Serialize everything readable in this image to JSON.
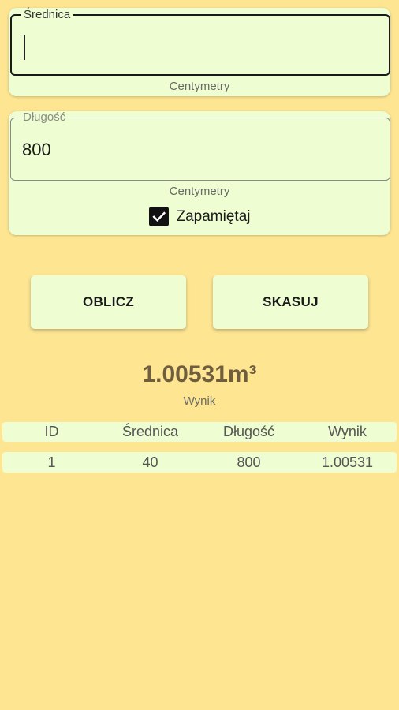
{
  "diameter": {
    "label": "Średnica",
    "value": "",
    "unit": "Centymetry"
  },
  "length": {
    "label": "Długość",
    "value": "800",
    "unit": "Centymetry",
    "remember_label": "Zapamiętaj",
    "remember_checked": true
  },
  "buttons": {
    "calculate": "OBLICZ",
    "clear": "SKASUJ"
  },
  "result": {
    "value": "1.00531m³",
    "label": "Wynik"
  },
  "table": {
    "headers": [
      "ID",
      "Średnica",
      "Długość",
      "Wynik"
    ],
    "rows": [
      [
        "1",
        "40",
        "800",
        "1.00531"
      ]
    ]
  }
}
